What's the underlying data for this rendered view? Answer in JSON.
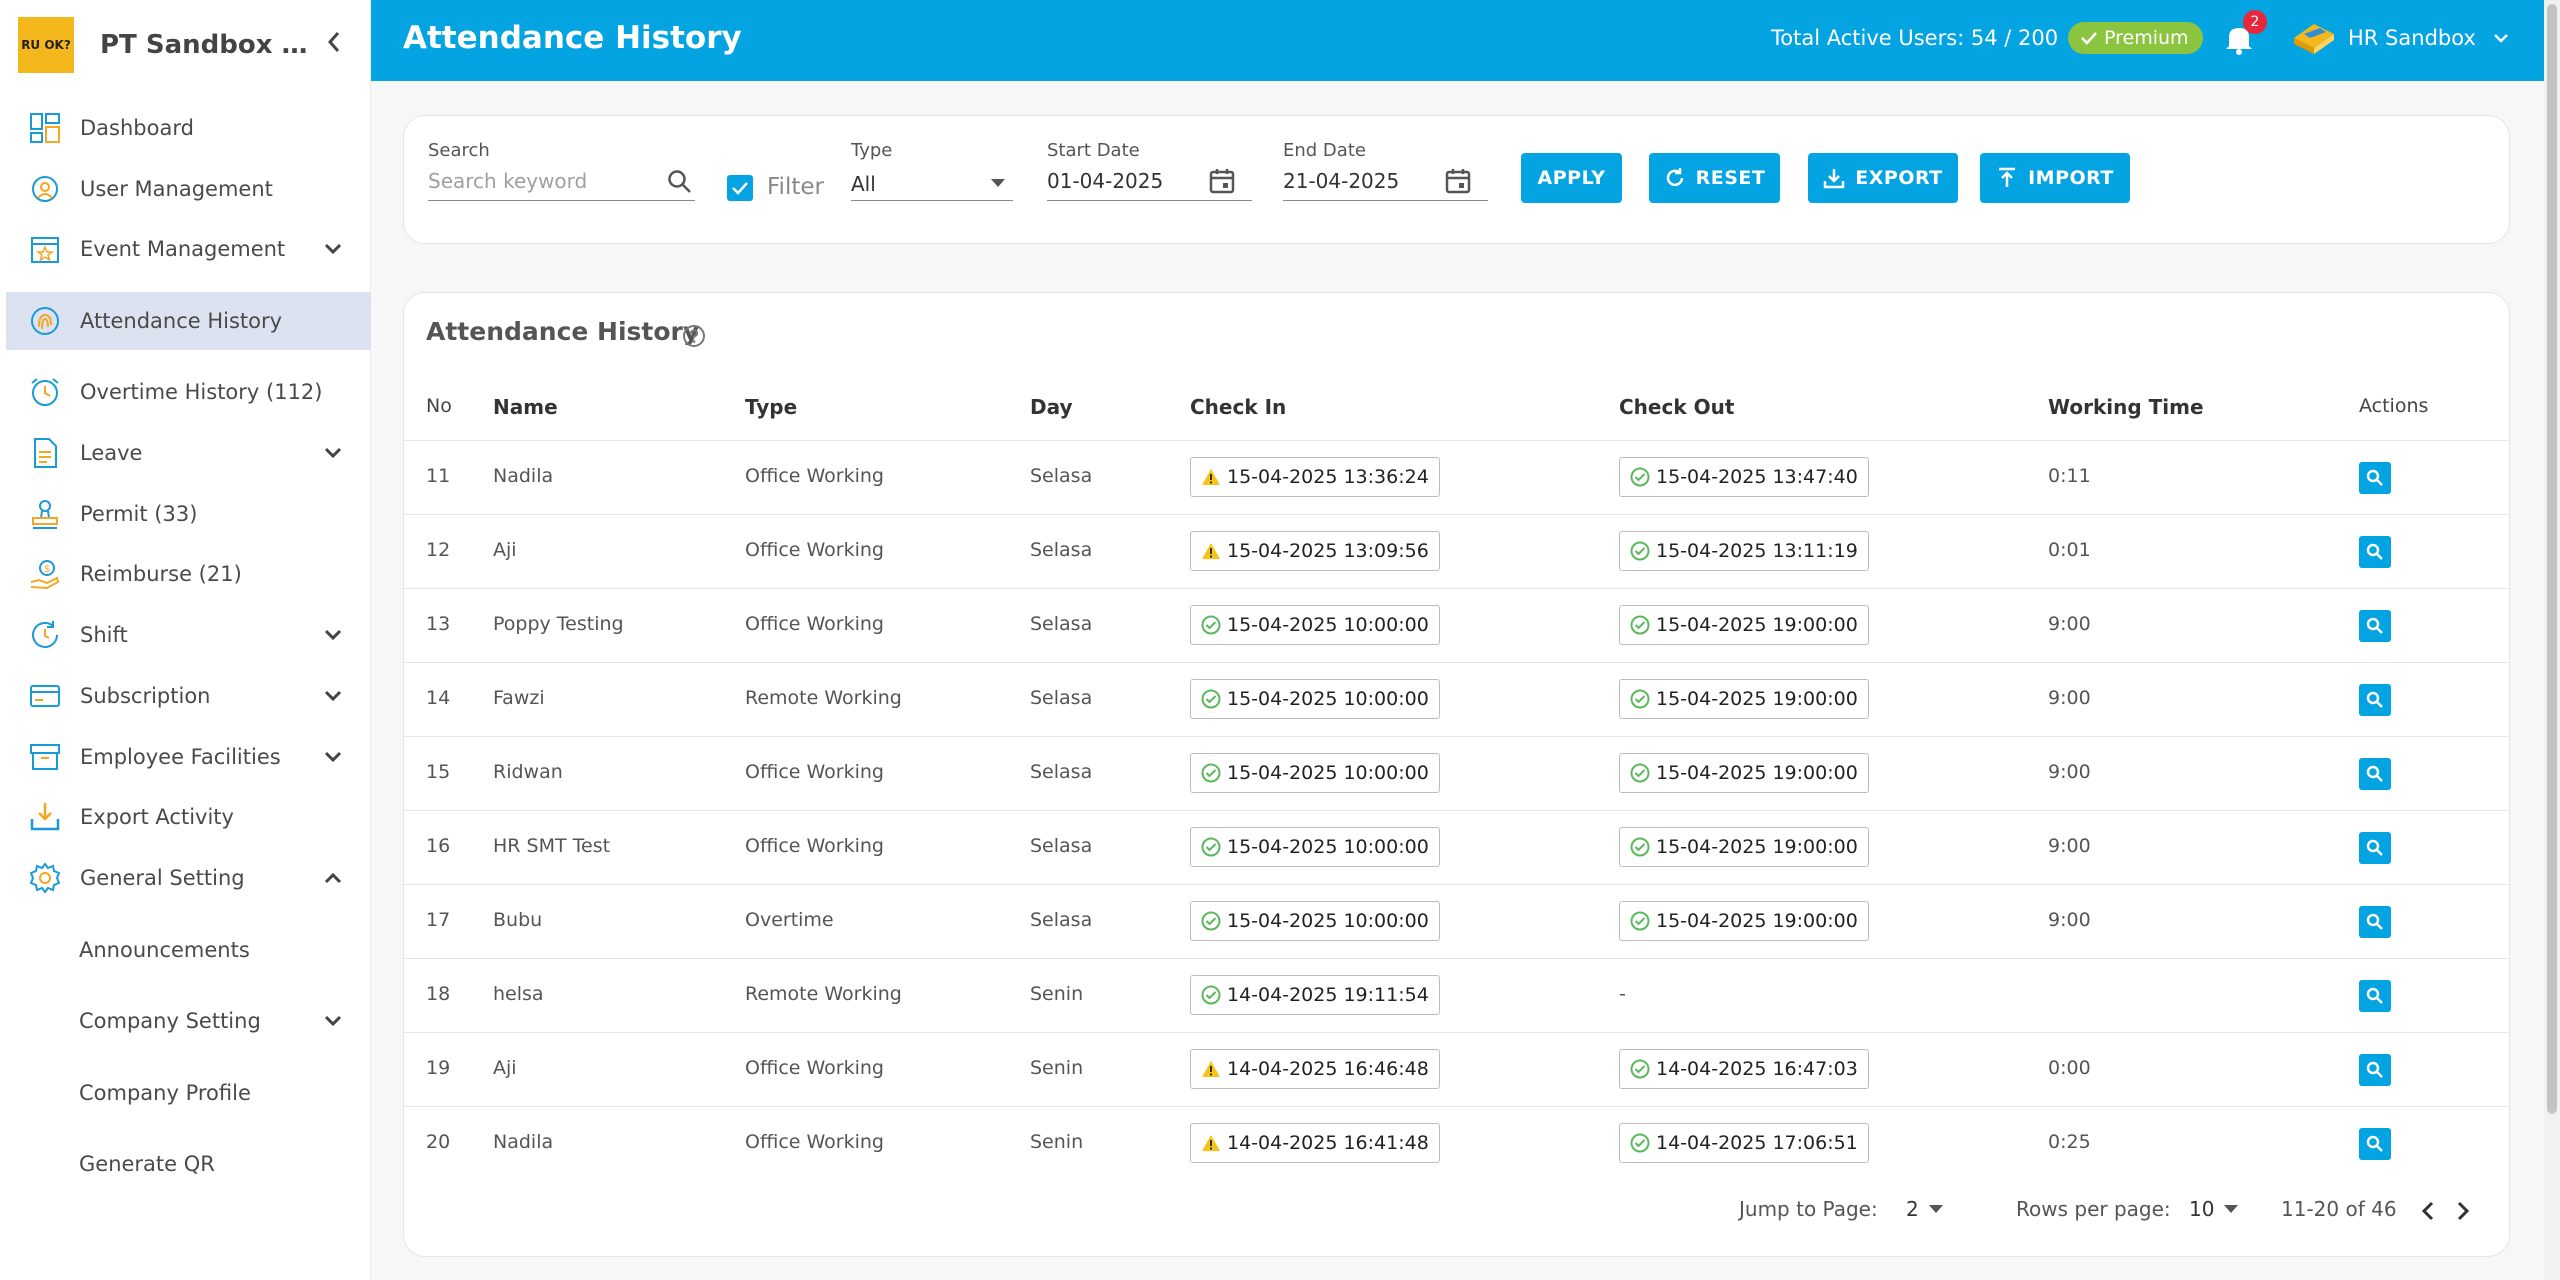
{
  "sidebar": {
    "brand_logo_text": "RU OK?",
    "brand_name": "PT Sandbox Ban...",
    "items": [
      {
        "label": "Dashboard",
        "icon": "dashboard-icon"
      },
      {
        "label": "User Management",
        "icon": "user-management-icon"
      },
      {
        "label": "Event Management",
        "icon": "calendar-star-icon",
        "expandable": true
      },
      {
        "label": "Attendance History",
        "icon": "fingerprint-icon",
        "active": true
      },
      {
        "label": "Overtime History (112)",
        "icon": "alarm-clock-icon"
      },
      {
        "label": "Leave",
        "icon": "document-icon",
        "expandable": true
      },
      {
        "label": "Permit (33)",
        "icon": "stamp-icon"
      },
      {
        "label": "Reimburse (21)",
        "icon": "money-hand-icon"
      },
      {
        "label": "Shift",
        "icon": "refresh-clock-icon",
        "expandable": true
      },
      {
        "label": "Subscription",
        "icon": "card-icon",
        "expandable": true
      },
      {
        "label": "Employee Facilities",
        "icon": "box-icon",
        "expandable": true
      },
      {
        "label": "Export Activity",
        "icon": "download-tray-icon"
      },
      {
        "label": "General Setting",
        "icon": "gear-icon",
        "expanded": true
      }
    ],
    "sub_items": [
      "Announcements",
      "Company Setting",
      "Company Profile",
      "Generate QR"
    ]
  },
  "header": {
    "title": "Attendance History",
    "total_users": "Total Active Users: 54 / 200",
    "premium": "Premium",
    "notification_count": "2",
    "user_name": "HR Sandbox"
  },
  "filters": {
    "search_label": "Search",
    "search_placeholder": "Search keyword",
    "filter_label": "Filter",
    "filter_checked": true,
    "type_label": "Type",
    "type_value": "All",
    "start_label": "Start Date",
    "start_value": "01-04-2025",
    "end_label": "End Date",
    "end_value": "21-04-2025",
    "apply": "APPLY",
    "reset": "RESET",
    "export": "EXPORT",
    "import": "IMPORT"
  },
  "table": {
    "title": "Attendance History",
    "columns": [
      "No",
      "Name",
      "Type",
      "Day",
      "Check In",
      "Check Out",
      "Working Time",
      "Actions"
    ],
    "rows": [
      {
        "no": "11",
        "name": "Nadila",
        "type": "Office Working",
        "day": "Selasa",
        "check_in": "15-04-2025 13:36:24",
        "in_status": "warning",
        "check_out": "15-04-2025 13:47:40",
        "out_status": "ok",
        "working": "0:11"
      },
      {
        "no": "12",
        "name": "Aji",
        "type": "Office Working",
        "day": "Selasa",
        "check_in": "15-04-2025 13:09:56",
        "in_status": "warning",
        "check_out": "15-04-2025 13:11:19",
        "out_status": "ok",
        "working": "0:01"
      },
      {
        "no": "13",
        "name": "Poppy Testing",
        "type": "Office Working",
        "day": "Selasa",
        "check_in": "15-04-2025 10:00:00",
        "in_status": "ok",
        "check_out": "15-04-2025 19:00:00",
        "out_status": "ok",
        "working": "9:00"
      },
      {
        "no": "14",
        "name": "Fawzi",
        "type": "Remote Working",
        "day": "Selasa",
        "check_in": "15-04-2025 10:00:00",
        "in_status": "ok",
        "check_out": "15-04-2025 19:00:00",
        "out_status": "ok",
        "working": "9:00"
      },
      {
        "no": "15",
        "name": "Ridwan",
        "type": "Office Working",
        "day": "Selasa",
        "check_in": "15-04-2025 10:00:00",
        "in_status": "ok",
        "check_out": "15-04-2025 19:00:00",
        "out_status": "ok",
        "working": "9:00"
      },
      {
        "no": "16",
        "name": "HR SMT Test",
        "type": "Office Working",
        "day": "Selasa",
        "check_in": "15-04-2025 10:00:00",
        "in_status": "ok",
        "check_out": "15-04-2025 19:00:00",
        "out_status": "ok",
        "working": "9:00"
      },
      {
        "no": "17",
        "name": "Bubu",
        "type": "Overtime",
        "day": "Selasa",
        "check_in": "15-04-2025 10:00:00",
        "in_status": "ok",
        "check_out": "15-04-2025 19:00:00",
        "out_status": "ok",
        "working": "9:00"
      },
      {
        "no": "18",
        "name": "helsa",
        "type": "Remote Working",
        "day": "Senin",
        "check_in": "14-04-2025 19:11:54",
        "in_status": "ok",
        "check_out": "-",
        "out_status": "none",
        "working": ""
      },
      {
        "no": "19",
        "name": "Aji",
        "type": "Office Working",
        "day": "Senin",
        "check_in": "14-04-2025 16:46:48",
        "in_status": "warning",
        "check_out": "14-04-2025 16:47:03",
        "out_status": "ok",
        "working": "0:00"
      },
      {
        "no": "20",
        "name": "Nadila",
        "type": "Office Working",
        "day": "Senin",
        "check_in": "14-04-2025 16:41:48",
        "in_status": "warning",
        "check_out": "14-04-2025 17:06:51",
        "out_status": "ok",
        "working": "0:25"
      }
    ]
  },
  "pagination": {
    "jump_label": "Jump to Page:",
    "page": "2",
    "rows_label": "Rows per page:",
    "rows_per_page": "10",
    "range": "11-20 of 46"
  },
  "colors": {
    "primary": "#04a4e3",
    "premium": "#8bc53f",
    "badge": "#e8263c",
    "warning": "#f5c518",
    "ok": "#5cb85c",
    "active_nav": "#dde2f1"
  }
}
